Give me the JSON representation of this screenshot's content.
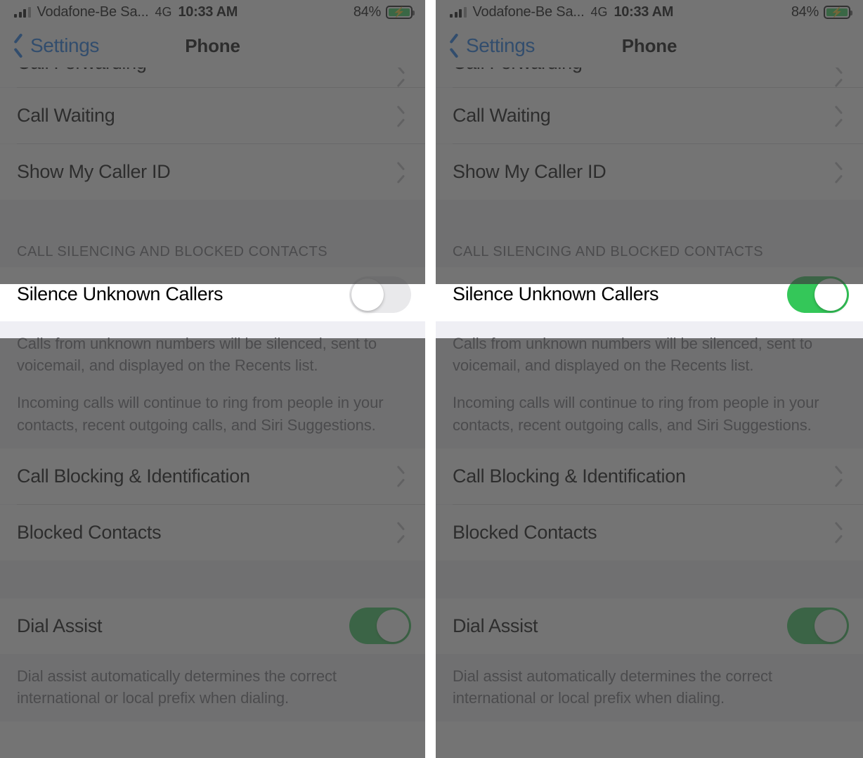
{
  "status_bar": {
    "carrier": "Vodafone-Be Sa...",
    "network": "4G",
    "time": "10:33 AM",
    "battery_percent": "84%",
    "battery_charging": true,
    "signal_bars": 3,
    "battery_color": "#30d158"
  },
  "nav": {
    "back_label": "Settings",
    "title": "Phone",
    "accent_color": "#1273e5"
  },
  "list": {
    "clipped_row_label": "Call Forwarding",
    "rows_top": [
      {
        "label": "Call Waiting",
        "accessory": "chevron-right-icon"
      },
      {
        "label": "Show My Caller ID",
        "accessory": "chevron-right-icon"
      }
    ],
    "section_header": "CALL SILENCING AND BLOCKED CONTACTS",
    "highlighted_row": {
      "label": "Silence Unknown Callers",
      "accessory": "toggle-switch"
    },
    "silence_footer": [
      "Calls from unknown numbers will be silenced, sent to voicemail, and displayed on the Recents list.",
      "Incoming calls will continue to ring from people in your contacts, recent outgoing calls, and Siri Suggestions."
    ],
    "rows_mid": [
      {
        "label": "Call Blocking & Identification",
        "accessory": "chevron-right-icon"
      },
      {
        "label": "Blocked Contacts",
        "accessory": "chevron-right-icon"
      }
    ],
    "dial_assist": {
      "label": "Dial Assist",
      "accessory": "toggle-switch"
    },
    "dial_assist_footer": "Dial assist automatically determines the correct international or local prefix when dialing."
  },
  "panels": {
    "left": {
      "silence_unknown_callers_state": "off",
      "dial_assist_state": "on"
    },
    "right": {
      "silence_unknown_callers_state": "on",
      "dial_assist_state": "on"
    }
  },
  "colors": {
    "toggle_on": "#34c759",
    "toggle_off": "#e9e9eb",
    "dim_overlay": "#3f3f3f",
    "group_background": "#efeff4",
    "separator": "#d3d3d6",
    "secondary_text": "#6d6d72"
  }
}
